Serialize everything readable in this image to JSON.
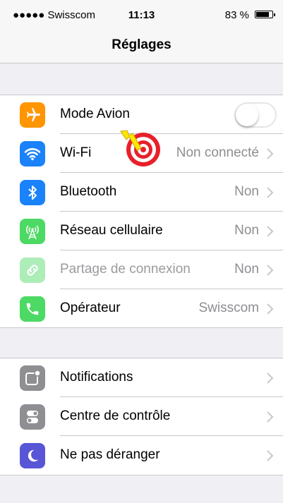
{
  "status_bar": {
    "signal": "●●●●● Swisscom",
    "time": "11:13",
    "battery": "83 %",
    "battery_level": 0.83
  },
  "nav": {
    "title": "Réglages"
  },
  "colors": {
    "airplane": "#ff9500",
    "wifi": "#1a82fb",
    "bluetooth": "#1a82fb",
    "cellular": "#4cd964",
    "hotspot": "#4cd964",
    "carrier": "#4cd964",
    "notifications": "#8e8e93",
    "control_center": "#8e8e93",
    "do_not_disturb": "#5856d6",
    "target_red": "#e8202a",
    "target_arrow": "#ffe600"
  },
  "group1": {
    "airplane": {
      "label": "Mode Avion",
      "icon": "airplane-icon",
      "toggle_on": false
    },
    "wifi": {
      "label": "Wi-Fi",
      "value": "Non connecté",
      "icon": "wifi-icon"
    },
    "bluetooth": {
      "label": "Bluetooth",
      "value": "Non",
      "icon": "bluetooth-icon"
    },
    "cellular": {
      "label": "Réseau cellulaire",
      "value": "Non",
      "icon": "antenna-icon"
    },
    "hotspot": {
      "label": "Partage de connexion",
      "value": "Non",
      "icon": "link-icon",
      "disabled": true
    },
    "carrier": {
      "label": "Opérateur",
      "value": "Swisscom",
      "icon": "phone-icon"
    }
  },
  "group2": {
    "notifications": {
      "label": "Notifications",
      "icon": "notifications-icon"
    },
    "control_center": {
      "label": "Centre de contrôle",
      "icon": "control-center-icon"
    },
    "do_not_disturb": {
      "label": "Ne pas déranger",
      "icon": "moon-icon"
    }
  },
  "overlay": {
    "icon": "target-pointer-icon"
  }
}
